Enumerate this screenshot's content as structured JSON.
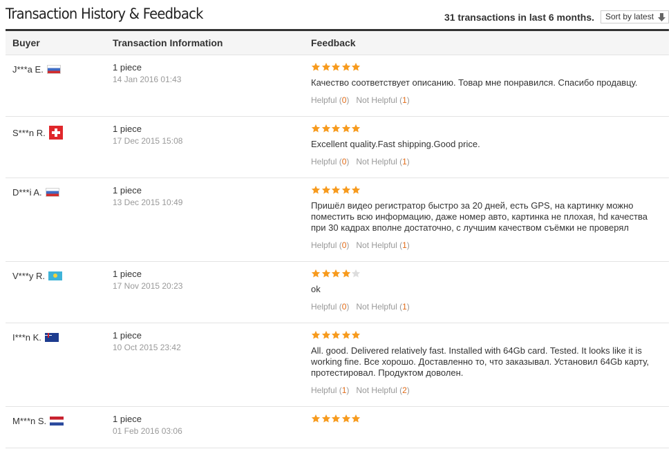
{
  "header": {
    "title": "Transaction History & Feedback",
    "summary": "31 transactions in last 6 months.",
    "sort_label": "Sort by latest"
  },
  "columns": {
    "buyer": "Buyer",
    "info": "Transaction Information",
    "feedback": "Feedback"
  },
  "colors": {
    "star_filled": "#f79b1e",
    "star_empty": "#dddddd",
    "vote_count": "#e06a16",
    "muted": "#999999"
  },
  "rows": [
    {
      "buyer": "J***a E.",
      "flag": "ru",
      "qty": "1 piece",
      "date": "14 Jan 2016 01:43",
      "rating": 5,
      "text": "Качество соответствует описанию. Товар мне понравился. Спасибо продавцу.",
      "helpful_label": "Helpful",
      "helpful_count": "0",
      "not_helpful_label": "Not Helpful",
      "not_helpful_count": "1"
    },
    {
      "buyer": "S***n R.",
      "flag": "ch",
      "qty": "1 piece",
      "date": "17 Dec 2015 15:08",
      "rating": 5,
      "text": "Excellent quality.Fast shipping.Good price.",
      "helpful_label": "Helpful",
      "helpful_count": "0",
      "not_helpful_label": "Not Helpful",
      "not_helpful_count": "1"
    },
    {
      "buyer": "D***i A.",
      "flag": "ru",
      "qty": "1 piece",
      "date": "13 Dec 2015 10:49",
      "rating": 5,
      "text": "Пришёл видео регистратор быстро за 20 дней, есть GPS, на картинку можно поместить всю информацию, даже номер авто, картинка не плохая, hd качества при 30 кадрах вполне достаточно, с лучшим качеством съёмки не проверял",
      "helpful_label": "Helpful",
      "helpful_count": "0",
      "not_helpful_label": "Not Helpful",
      "not_helpful_count": "1"
    },
    {
      "buyer": "V***y R.",
      "flag": "kz",
      "qty": "1 piece",
      "date": "17 Nov 2015 20:23",
      "rating": 4,
      "text": "ok",
      "helpful_label": "Helpful",
      "helpful_count": "0",
      "not_helpful_label": "Not Helpful",
      "not_helpful_count": "1"
    },
    {
      "buyer": "I***n K.",
      "flag": "au",
      "qty": "1 piece",
      "date": "10 Oct 2015 23:42",
      "rating": 5,
      "text": "All. good. Delivered relatively fast. Installed with 64Gb card. Tested. It looks like it is working fine. Все хорошо. Доставленно то, что заказывал. Установил 64Gb карту, протестировал. Продуктом доволен.",
      "helpful_label": "Helpful",
      "helpful_count": "1",
      "not_helpful_label": "Not Helpful",
      "not_helpful_count": "2"
    },
    {
      "buyer": "M***n S.",
      "flag": "nl",
      "qty": "1 piece",
      "date": "01 Feb 2016 03:06",
      "rating": 5,
      "text": "",
      "helpful_label": "",
      "helpful_count": "",
      "not_helpful_label": "",
      "not_helpful_count": ""
    }
  ]
}
